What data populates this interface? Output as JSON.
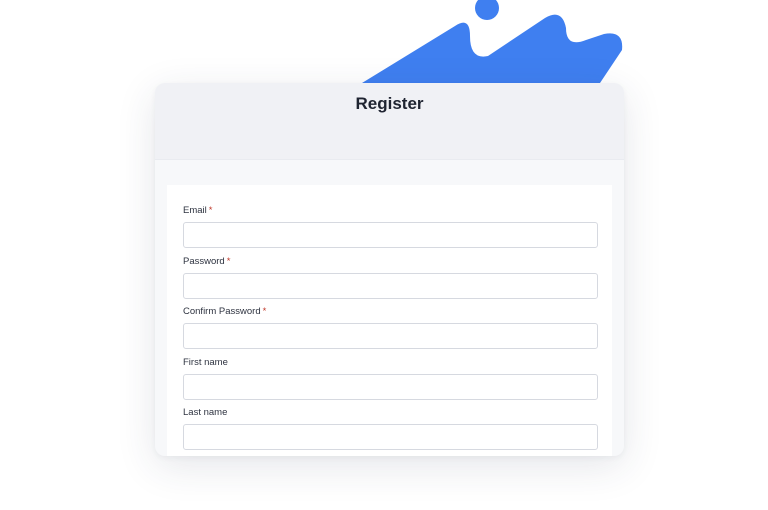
{
  "page": {
    "title": "Register"
  },
  "form": {
    "fields": [
      {
        "label": "Email",
        "required_mark": "*",
        "value": "",
        "placeholder": ""
      },
      {
        "label": "Password",
        "required_mark": "*",
        "value": "",
        "placeholder": ""
      },
      {
        "label": "Confirm Password",
        "required_mark": "*",
        "value": "",
        "placeholder": ""
      },
      {
        "label": "First name",
        "required_mark": "",
        "value": "",
        "placeholder": ""
      },
      {
        "label": "Last name",
        "required_mark": "",
        "value": "",
        "placeholder": ""
      }
    ]
  },
  "colors": {
    "accent": "#3f7ff0",
    "required": "#c0392b"
  }
}
